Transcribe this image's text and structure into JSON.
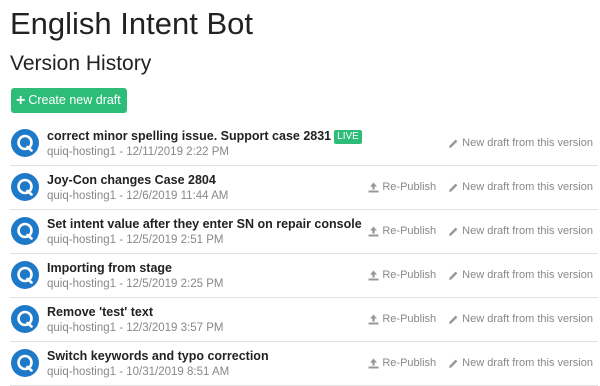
{
  "header": {
    "app_title": "English Intent Bot",
    "section_title": "Version History"
  },
  "toolbar": {
    "create_label": "Create new draft"
  },
  "colors": {
    "accent_green": "#2ebd78",
    "avatar_blue": "#1f79c9"
  },
  "actions": {
    "republish_label": "Re-Publish",
    "new_draft_label": "New draft from this version"
  },
  "versions": [
    {
      "message": "correct minor spelling issue. Support case 2831",
      "badge": "LIVE",
      "meta": "quiq-hosting1 - 12/11/2019 2:22 PM"
    },
    {
      "message": "Joy-Con changes Case 2804",
      "meta": "quiq-hosting1 - 12/6/2019 11:44 AM"
    },
    {
      "message": "Set intent value after they enter SN on repair console",
      "meta": "quiq-hosting1 - 12/5/2019 2:51 PM"
    },
    {
      "message": "Importing from stage",
      "meta": "quiq-hosting1 - 12/5/2019 2:25 PM"
    },
    {
      "message": "Remove 'test' text",
      "meta": "quiq-hosting1 - 12/3/2019 3:57 PM"
    },
    {
      "message": "Switch keywords and typo correction",
      "meta": "quiq-hosting1 - 10/31/2019 8:51 AM"
    }
  ]
}
